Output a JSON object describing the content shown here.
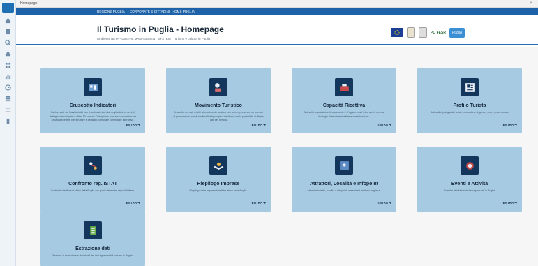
{
  "topbar": {
    "tab_label": "Homepage",
    "close_glyph": "×"
  },
  "breadcrumb": [
    "REGIONE PUGLIA",
    "CORPORATE E CITTADINI",
    "DMS PUGLIA"
  ],
  "header": {
    "title": "Il Turismo in Puglia - Homepage",
    "subtitle": "Ambiente BETA - DIGITAL MANAGEMENT SYSTEM | Turismo e cultura in Puglia",
    "logos": [
      "eu-flag-logo",
      "region-seal-logo",
      "partner-logo",
      "puglia-brand-logo"
    ],
    "partner_logo_text": "PO FESR",
    "puglia_logo_text": "Puglia"
  },
  "rail": {
    "icons": [
      "home-icon",
      "building-icon",
      "search-icon",
      "car-icon",
      "grid-icon",
      "chart-icon",
      "clock-icon",
      "stack-icon",
      "list-icon",
      "settings-icon"
    ]
  },
  "cards": [
    {
      "title": "Cruscotto Indicatori",
      "icon": "dashboard-icon",
      "desc_pre": "Dati annuali sui flussi turistici con il confronto tra i dati degli ultimi tre anni, il dettaglio dei soli primi e ultimi 10 comuni. Dettagli per comune o provenienza",
      "desc_bold": "",
      "desc_post": "e capacità ricettiva, per strutture e dettaglio comunale con mappe interattive.",
      "cta": "ENTRA"
    },
    {
      "title": "Movimento Turistico",
      "icon": "movement-icon",
      "desc_pre": "Cruscotto dei dati relativi al movimento turistico con arrivi e presenze per comuni di provenienza, ambiti territoriali e tipologia di strutture, con la possibilità di filtrare i dati per periodo.",
      "desc_bold": "",
      "desc_post": "",
      "cta": "ENTRA"
    },
    {
      "title": "Capacità Ricettiva",
      "icon": "hotel-icon",
      "desc_pre": "Dati sulla capacità ricettiva presente in Puglia e posti letto, con le diverse tipologie di strutture ricettive e classificazione.",
      "desc_bold": "",
      "desc_post": "",
      "cta": "ENTRA"
    },
    {
      "title": "Profilo Turista",
      "icon": "profile-icon",
      "desc_pre": "Dati sulla tipologia dei turisti, in relazione al genere, età e provenienza.",
      "desc_bold": "",
      "desc_post": "",
      "cta": "ENTRA"
    },
    {
      "title": "Confronto reg. ISTAT",
      "icon": "compare-icon",
      "desc_pre": "Confronto dei flussi turistici della Puglia con quelli delle altre regioni italiane.",
      "desc_bold": "",
      "desc_post": "",
      "cta": "ENTRA"
    },
    {
      "title": "Riepilogo Imprese",
      "icon": "business-icon",
      "desc_pre": "Riepilogo delle imprese turistiche attive nella Puglia.",
      "desc_bold": "",
      "desc_post": "",
      "cta": "ENTRA"
    },
    {
      "title": "Attrattori, Località e Infopoint",
      "icon": "map-icon",
      "desc_pre": "Attrattori turistici, località e infopoint presenti sul territorio pugliese.",
      "desc_bold": "",
      "desc_post": "",
      "cta": "ENTRA"
    },
    {
      "title": "Eventi e Attività",
      "icon": "events-icon",
      "desc_pre": "Eventi e attività turistiche organizzati in Puglia.",
      "desc_bold": "",
      "desc_post": "",
      "cta": "ENTRA"
    },
    {
      "title": "Estrazione dati",
      "icon": "export-icon",
      "desc_pre": "Sezione di estrazione e download dei dati riguardanti il turismo in Puglia.",
      "desc_bold": "",
      "desc_post": "",
      "cta": ""
    }
  ],
  "colors": {
    "accent": "#1d62a8",
    "card": "#a7cae3",
    "icon_box": "#13365c"
  }
}
